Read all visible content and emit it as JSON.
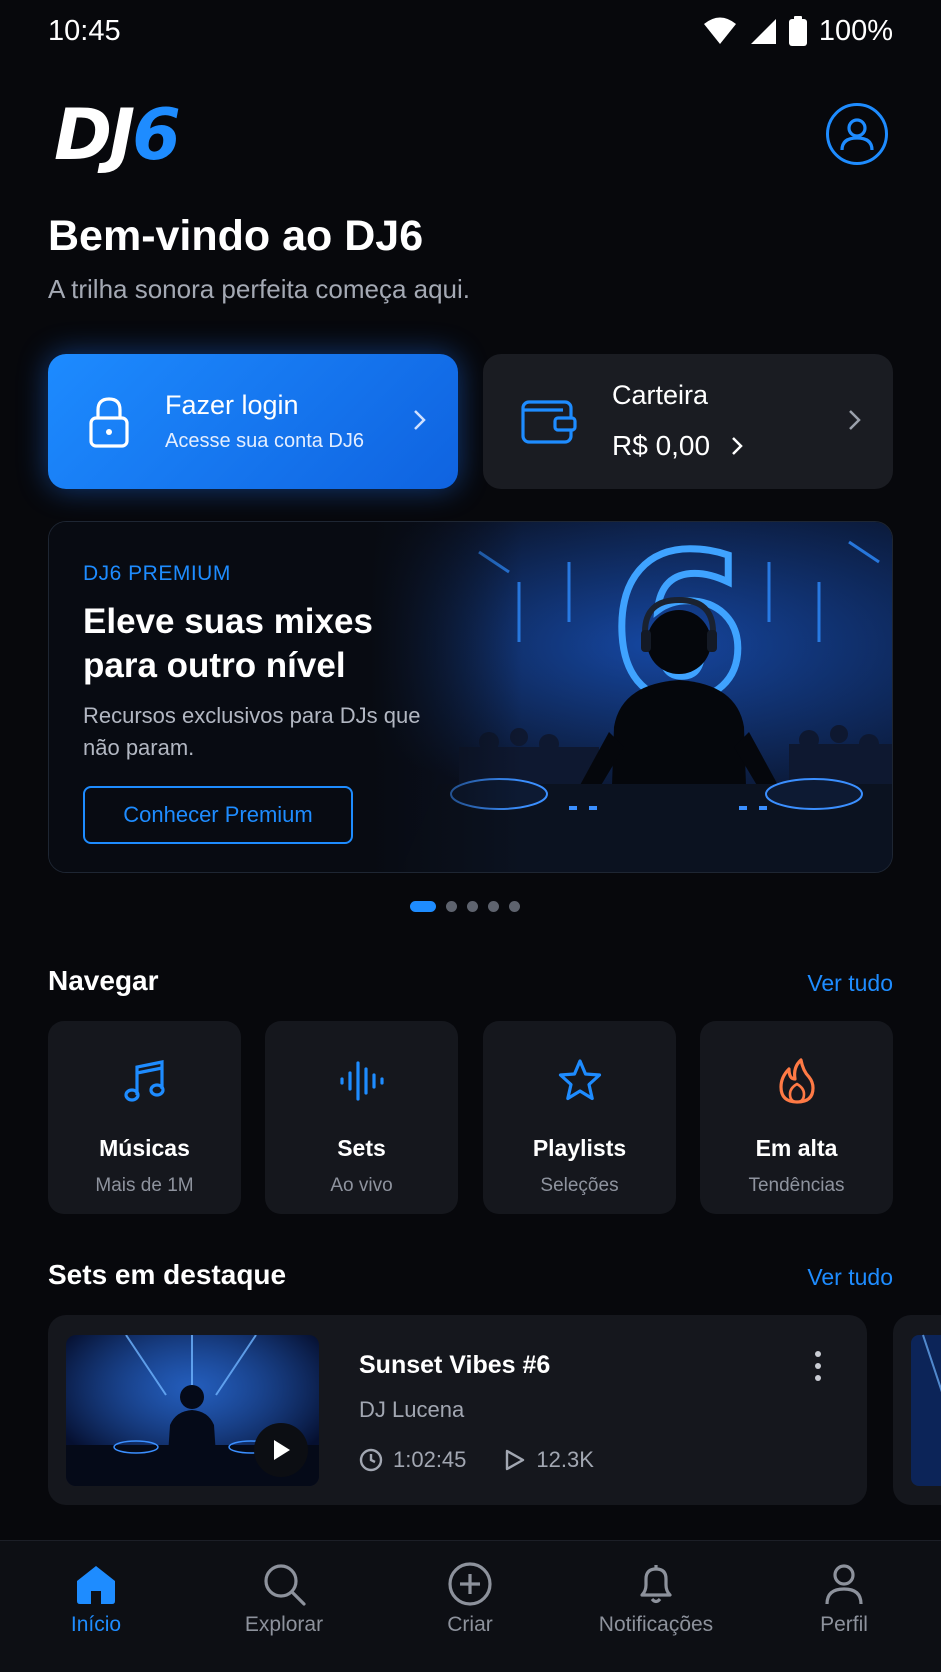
{
  "status_bar": {
    "time": "10:45",
    "battery": "100%"
  },
  "header": {
    "logo_part1": "DJ",
    "logo_part2": "6"
  },
  "welcome": {
    "title": "Bem-vindo ao DJ6",
    "subtitle": "A trilha sonora perfeita começa aqui."
  },
  "login_card": {
    "title": "Fazer login",
    "subtitle": "Acesse sua conta DJ6"
  },
  "wallet_card": {
    "title": "Carteira",
    "amount": "R$ 0,00"
  },
  "premium": {
    "label": "DJ6 PREMIUM",
    "title": "Eleve suas mixes para outro nível",
    "description": "Recursos exclusivos para DJs que não param.",
    "button": "Conhecer Premium",
    "artwork_numeral": "6"
  },
  "carousel": {
    "count": 5,
    "active": 0
  },
  "browse": {
    "title": "Navegar",
    "see_all": "Ver tudo",
    "items": [
      {
        "label": "Músicas",
        "sub": "Mais de 1M",
        "icon": "music-note-icon"
      },
      {
        "label": "Sets",
        "sub": "Ao vivo",
        "icon": "waveform-icon"
      },
      {
        "label": "Playlists",
        "sub": "Seleções",
        "icon": "star-icon"
      },
      {
        "label": "Em alta",
        "sub": "Tendências",
        "icon": "flame-icon"
      }
    ]
  },
  "featured": {
    "title": "Sets em destaque",
    "see_all": "Ver tudo",
    "sets": [
      {
        "title": "Sunset Vibes #6",
        "artist": "DJ Lucena",
        "duration": "1:02:45",
        "plays": "12.3K"
      }
    ]
  },
  "bottom_nav": {
    "items": [
      {
        "label": "Início",
        "icon": "home-icon",
        "active": true
      },
      {
        "label": "Explorar",
        "icon": "search-icon",
        "active": false
      },
      {
        "label": "Criar",
        "icon": "plus-circle-icon",
        "active": false
      },
      {
        "label": "Notificações",
        "icon": "bell-icon",
        "active": false
      },
      {
        "label": "Perfil",
        "icon": "user-icon",
        "active": false
      }
    ]
  },
  "colors": {
    "accent": "#1e8cff",
    "background": "#07080c",
    "card": "#15171d",
    "flame": "#ff7a45"
  }
}
